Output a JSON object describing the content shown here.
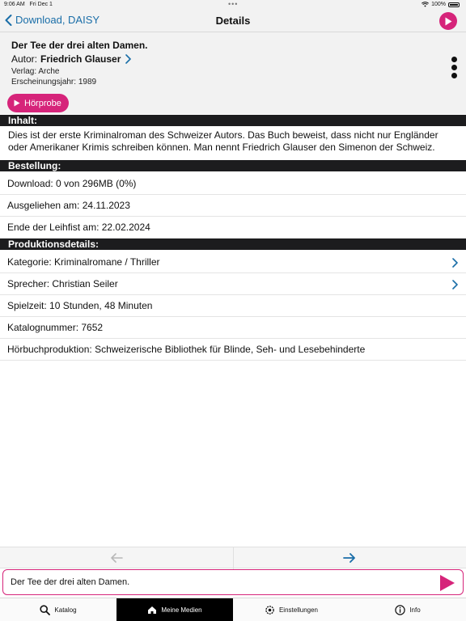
{
  "status_bar": {
    "time": "9:06 AM",
    "date": "Fri Dec 1",
    "battery": "100%"
  },
  "nav": {
    "back_label": "Download, DAISY",
    "title": "Details",
    "play_icon": "play-icon"
  },
  "book": {
    "title": "Der Tee der drei alten Damen.",
    "author_prefix": "Autor:",
    "author": "Friedrich Glauser",
    "publisher": "Verlag: Arche",
    "year": "Erscheinungsjahr: 1989",
    "sample_label": "Hörprobe"
  },
  "content": {
    "header": "Inhalt:",
    "text": "Dies ist der erste Kriminalroman des Schweizer Autors. Das Buch beweist, dass nicht nur Engländer oder Amerikaner Krimis schreiben können. Man nennt Friedrich Glauser den Simenon der Schweiz."
  },
  "order": {
    "header": "Bestellung:",
    "download": "Download: 0 von 296MB (0%)",
    "borrowed": "Ausgeliehen am: 24.11.2023",
    "due": "Ende der Leihfist am: 22.02.2024"
  },
  "production": {
    "header": "Produktionsdetails:",
    "category": "Kategorie: Kriminalromane / Thriller",
    "narrator": "Sprecher: Christian Seiler",
    "duration": "Spielzeit: 10 Stunden, 48 Minuten",
    "catalog_no": "Katalognummer: 7652",
    "producer": "Hörbuchproduktion: Schweizerische Bibliothek für Blinde, Seh- und Lesebehinderte"
  },
  "player": {
    "title": "Der Tee der drei alten Damen."
  },
  "tabs": [
    {
      "label": "Katalog",
      "icon": "search-icon"
    },
    {
      "label": "Meine Medien",
      "icon": "home-icon"
    },
    {
      "label": "Einstellungen",
      "icon": "gear-icon"
    },
    {
      "label": "Info",
      "icon": "info-icon"
    }
  ],
  "colors": {
    "accent": "#d6247a",
    "link": "#1a6ea8",
    "section_bar": "#1c1c1e"
  }
}
